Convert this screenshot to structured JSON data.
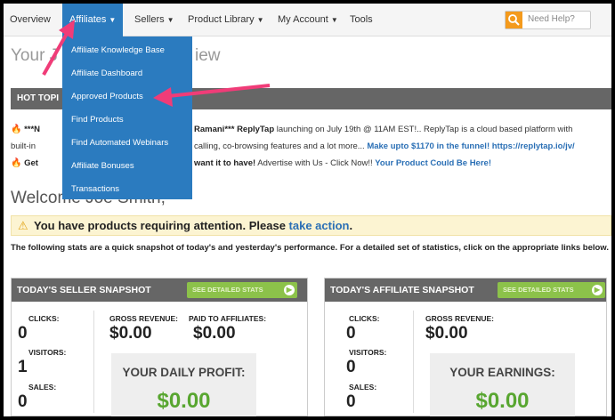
{
  "nav": {
    "items": [
      {
        "label": "Overview"
      },
      {
        "label": "Affiliates"
      },
      {
        "label": "Sellers"
      },
      {
        "label": "Product Library"
      },
      {
        "label": "My Account"
      },
      {
        "label": "Tools"
      }
    ],
    "help_placeholder": "Need Help?"
  },
  "dropdown": {
    "items": [
      "Affiliate Knowledge Base",
      "Affiliate Dashboard",
      "Approved Products",
      "Find Products",
      "Find Automated Webinars",
      "Affiliate Bonuses",
      "Transactions"
    ]
  },
  "page": {
    "title_left": "Your J",
    "title_right": "iew",
    "hot_label": "HOT TOPI",
    "ticker1_a": "***N",
    "ticker1_b": "Ramani***",
    "ticker1_c": "ReplyTap",
    "ticker1_d": "launching on July 19th @ 11AM EST!.. ReplyTap is a cloud based platform with",
    "ticker2_a": "built-in",
    "ticker2_b": "calling, co-browsing features and a lot more...",
    "ticker2_link": "Make upto $1170 in the funnel! https://replytap.io/jv/",
    "ticker3_a": "Get",
    "ticker3_b": "want it to have!",
    "ticker3_c": "Advertise with Us - Click Now!!",
    "ticker3_link": "Your Product Could Be Here!",
    "welcome": "Welcome Joe Smith,",
    "alert_text": "You have products requiring attention. Please",
    "alert_link": "take action",
    "alert_end": ".",
    "stats_note": "The following stats are a quick snapshot of today's and yesterday's performance. For a detailed set of statistics, click on the appropriate links below."
  },
  "seller": {
    "title": "TODAY'S SELLER SNAPSHOT",
    "detail_label": "SEE DETAILED STATS",
    "clicks_label": "CLICKS:",
    "clicks_value": "0",
    "visitors_label": "VISITORS:",
    "visitors_value": "1",
    "sales_label": "SALES:",
    "sales_value": "0",
    "gross_label": "GROSS REVENUE:",
    "gross_value": "$0.00",
    "paid_label": "PAID TO AFFILIATES:",
    "paid_value": "$0.00",
    "profit_label": "YOUR DAILY PROFIT:",
    "profit_value": "$0.00"
  },
  "affiliate": {
    "title": "TODAY'S AFFILIATE SNAPSHOT",
    "detail_label": "SEE DETAILED STATS",
    "clicks_label": "CLICKS:",
    "clicks_value": "0",
    "visitors_label": "VISITORS:",
    "visitors_value": "0",
    "sales_label": "SALES:",
    "sales_value": "0",
    "gross_label": "GROSS REVENUE:",
    "gross_value": "$0.00",
    "earnings_label": "YOUR EARNINGS:",
    "earnings_value": "$0.00"
  },
  "colors": {
    "nav_active": "#2b7bbf",
    "profit_green": "#58a630",
    "annotation_arrow": "#f03c78",
    "detail_button": "#8cc24a"
  },
  "icons": [
    "search-icon",
    "flame-icon",
    "warning-icon",
    "play-circle-icon",
    "caret-down-icon"
  ]
}
